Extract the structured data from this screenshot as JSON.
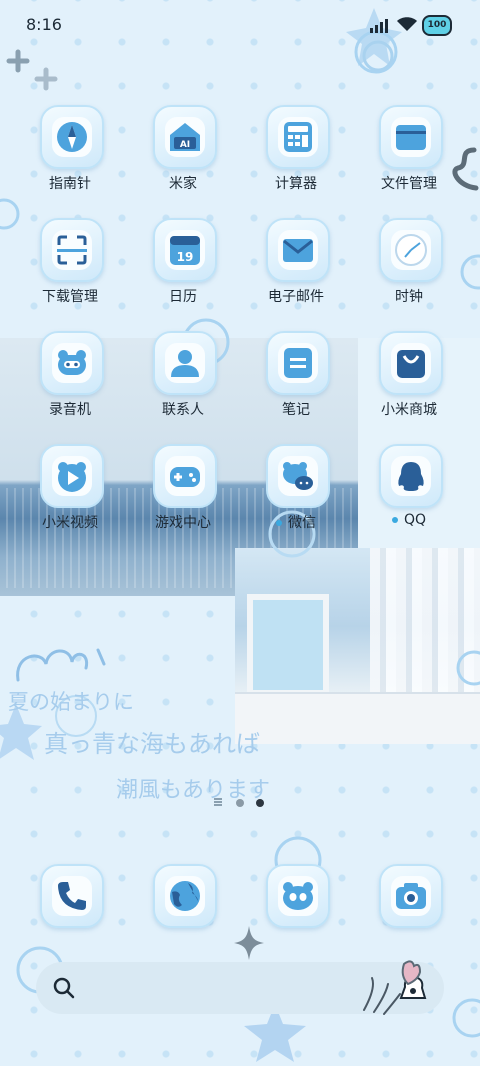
{
  "status_bar": {
    "time": "8:16",
    "battery": "100"
  },
  "apps": [
    {
      "label": "指南针",
      "icon": "compass-icon"
    },
    {
      "label": "米家",
      "icon": "mijia-home-icon"
    },
    {
      "label": "计算器",
      "icon": "calculator-icon"
    },
    {
      "label": "文件管理",
      "icon": "folder-icon"
    },
    {
      "label": "下载管理",
      "icon": "download-manager-icon"
    },
    {
      "label": "日历",
      "icon": "calendar-icon",
      "day": "19"
    },
    {
      "label": "电子邮件",
      "icon": "mail-icon"
    },
    {
      "label": "时钟",
      "icon": "clock-icon"
    },
    {
      "label": "录音机",
      "icon": "recorder-icon"
    },
    {
      "label": "联系人",
      "icon": "contacts-icon"
    },
    {
      "label": "笔记",
      "icon": "notes-icon"
    },
    {
      "label": "小米商城",
      "icon": "shopping-bag-icon"
    },
    {
      "label": "小米视频",
      "icon": "video-play-icon"
    },
    {
      "label": "游戏中心",
      "icon": "gamepad-icon"
    },
    {
      "label": "微信",
      "icon": "wechat-icon",
      "new": true
    },
    {
      "label": "QQ",
      "icon": "qq-penguin-icon",
      "new": true
    }
  ],
  "mijia_badge": "AI",
  "wallpaper_text": {
    "line1": "夏の始まりに",
    "line2": "真っ青な海もあれば",
    "line3": "潮風もあります"
  },
  "dock": [
    {
      "icon": "phone-icon"
    },
    {
      "icon": "browser-globe-icon"
    },
    {
      "icon": "messages-bear-icon"
    },
    {
      "icon": "camera-icon"
    }
  ],
  "colors": {
    "accent": "#3f8fd0",
    "icon_fill": "#4da3dd",
    "icon_dark": "#2a5f98"
  }
}
